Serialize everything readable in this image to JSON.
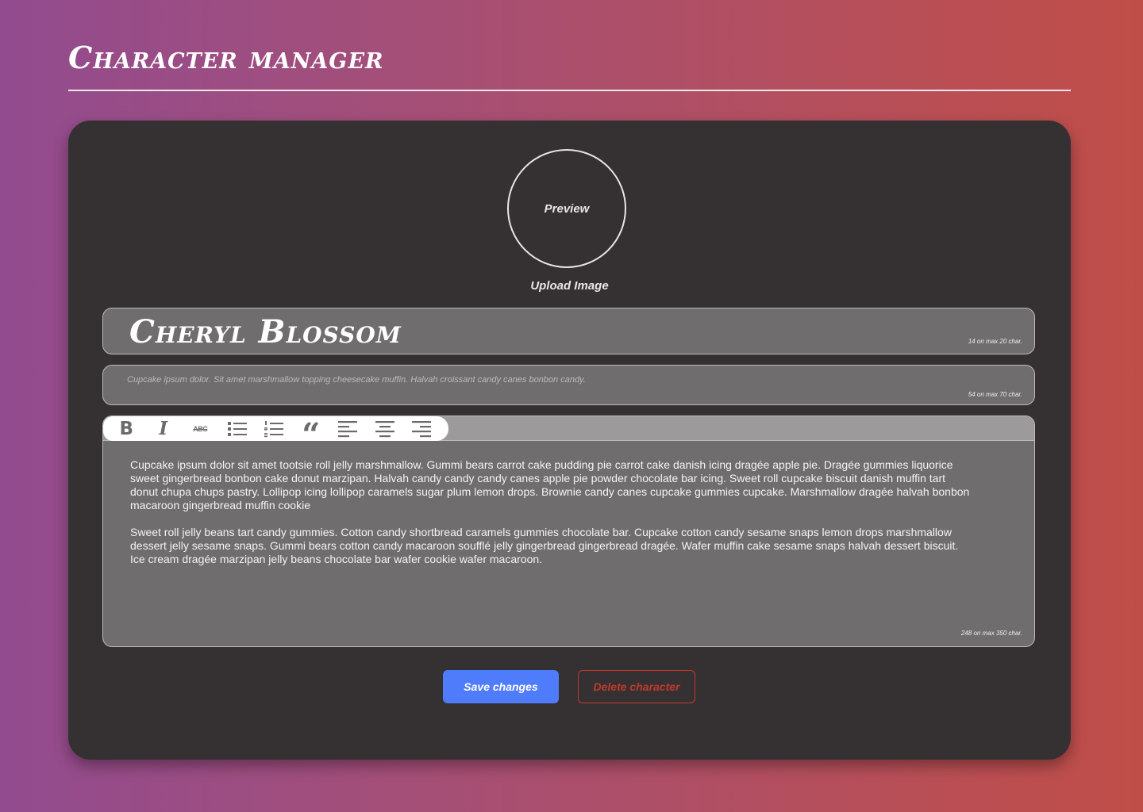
{
  "header": {
    "title": "Character manager"
  },
  "avatar": {
    "preview_label": "Preview",
    "upload_label": "Upload Image"
  },
  "name_field": {
    "value": "Cheryl Blossom",
    "counter": "14 on max 20 char."
  },
  "short_description": {
    "placeholder": "Cupcake ipsum dolor. Sit amet marshmallow topping cheesecake muffin. Halvah croissant candy canes bonbon candy.",
    "counter": "54 on max 70 char."
  },
  "editor": {
    "toolbar": {
      "bold": "B",
      "italic": "I",
      "strike": "ABC",
      "quote": "“",
      "icons": [
        "bold-icon",
        "italic-icon",
        "strikethrough-icon",
        "bullet-list-icon",
        "numbered-list-icon",
        "quote-icon",
        "align-left-icon",
        "align-center-icon",
        "align-right-icon"
      ]
    },
    "paragraphs": [
      "Cupcake ipsum dolor sit amet tootsie roll jelly marshmallow. Gummi bears carrot cake pudding pie carrot cake danish icing dragée apple pie. Dragée gummies liquorice sweet gingerbread bonbon cake donut marzipan. Halvah candy candy candy canes apple pie powder chocolate bar icing. Sweet roll cupcake biscuit danish muffin tart donut chupa chups pastry. Lollipop icing lollipop caramels sugar plum lemon drops. Brownie candy canes cupcake gummies cupcake. Marshmallow dragée halvah bonbon macaroon gingerbread muffin cookie",
      " Sweet roll jelly beans tart candy gummies. Cotton candy shortbread caramels gummies chocolate bar. Cupcake cotton candy sesame snaps lemon drops marshmallow dessert jelly sesame snaps. Gummi bears cotton candy macaroon soufflé jelly gingerbread gingerbread dragée. Wafer muffin cake sesame snaps halvah dessert biscuit. Ice cream dragée marzipan jelly beans chocolate bar wafer cookie wafer macaroon."
    ],
    "counter": "248 on max 350 char."
  },
  "actions": {
    "save_label": "Save changes",
    "delete_label": "Delete character"
  },
  "colors": {
    "save": "#4f7cfb",
    "delete": "#c0392b",
    "card": "#353132",
    "field": "#706d6e"
  }
}
